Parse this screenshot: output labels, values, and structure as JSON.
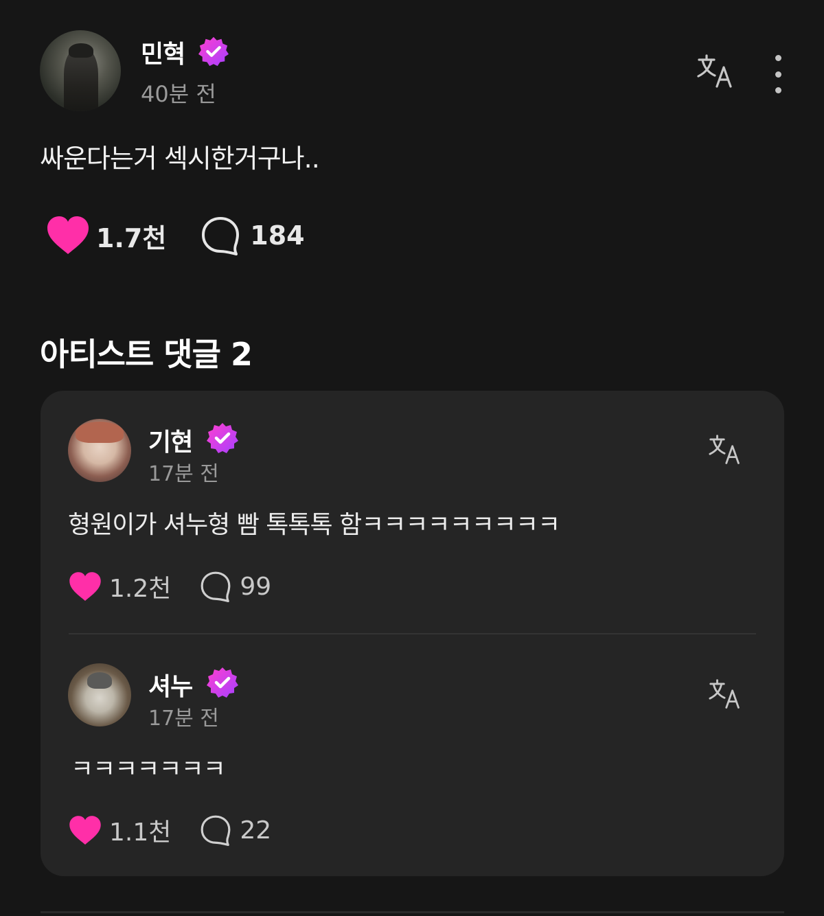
{
  "post": {
    "author": "민혁",
    "time": "40분 전",
    "body": "싸운다는거 섹시한거구나..",
    "likes": "1.7천",
    "comments": "184"
  },
  "artist_comments": {
    "title": "아티스트 댓글 2",
    "items": [
      {
        "author": "기현",
        "time": "17분 전",
        "body": "형원이가 셔누형 빰 톡톡톡 함ㅋㅋㅋㅋㅋㅋㅋㅋㅋ",
        "likes": "1.2천",
        "replies": "99"
      },
      {
        "author": "셔누",
        "time": "17분 전",
        "body": "ㅋㅋㅋㅋㅋㅋㅋ",
        "likes": "1.1천",
        "replies": "22"
      }
    ]
  },
  "icons": {
    "verified": "verified-badge-icon",
    "translate": "translate-icon",
    "more": "more-vertical-icon",
    "like": "heart-icon",
    "comment": "comment-bubble-icon"
  },
  "colors": {
    "background": "#161616",
    "card": "#252525",
    "accent_pink": "#ff2fa8",
    "badge_gradient_start": "#ff3fd0",
    "badge_gradient_end": "#a640ff",
    "muted_text": "#9a9a9a"
  }
}
